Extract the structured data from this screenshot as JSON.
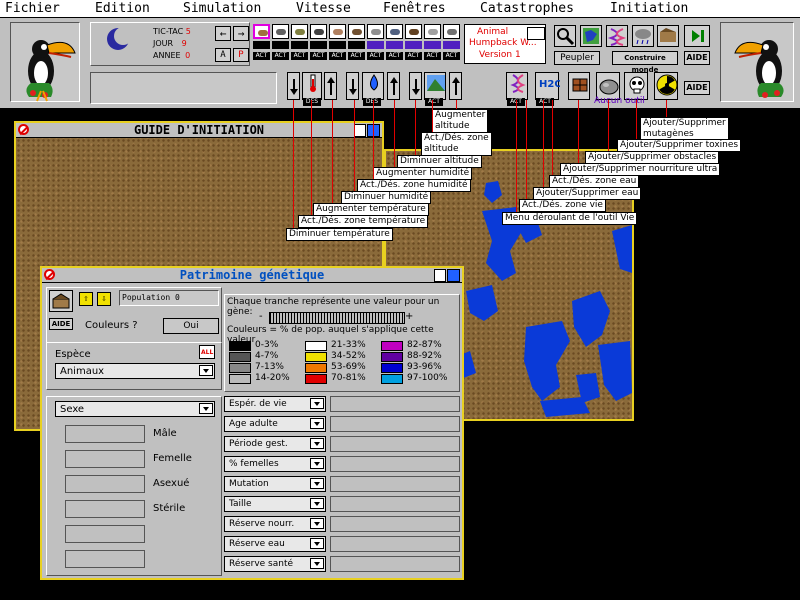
{
  "menu": [
    "Fichier",
    "Edition",
    "Simulation",
    "Vitesse",
    "Fenêtres",
    "Catastrophes",
    "Initiation"
  ],
  "counters": {
    "tictac_label": "TIC-TAC",
    "tictac_value": "5",
    "jour_label": "JOUR",
    "jour_value": "9",
    "annee_label": "ANNEE",
    "annee_value": "0"
  },
  "mode_buttons": {
    "a": "A",
    "p": "P"
  },
  "act_label": "ACT",
  "species_box": {
    "line1": "Animal",
    "line2": "Humpback W...",
    "line3": "Version 1"
  },
  "peupler": "Peupler",
  "construire_monde": "Construire monde",
  "aide": "AIDE",
  "des_label": "DES",
  "h2o_label": "H2O",
  "aucun_outil": "Aucun outil",
  "guide_title": "GUIDE D'INITIATION",
  "callouts": [
    "Augmenter\naltitude",
    "Act./Dés. zone\naltitude",
    "Diminuer altitude",
    "Augmenter humidité",
    "Act./Dés. zone humidité",
    "Diminuer humidité",
    "Augmenter température",
    "Act./Dés. zone température",
    "Diminuer température",
    "Ajouter/Supprimer\nmutagènes",
    "Ajouter/Supprimer toxines",
    "Ajouter/Supprimer obstacles",
    "Ajouter/Supprimer nourriture ultra",
    "Act./Dés. zone eau",
    "Ajouter/Supprimer eau",
    "Act./Dés. zone vie",
    "Menu déroulant de l'outil Vie"
  ],
  "genetic": {
    "title": "Patrimoine génétique",
    "population": "Population 0",
    "aide": "AIDE",
    "couleurs_label": "Couleurs ?",
    "oui": "Oui",
    "tranche_text": "Chaque tranche représente une valeur pour un gène:",
    "minus": "-",
    "plus": "+",
    "couleurs_text": "Couleurs = % de pop. auquel s'applique cette valeur",
    "legend": [
      {
        "label": "0-3%",
        "color": "#000000"
      },
      {
        "label": "4-7%",
        "color": "#555555"
      },
      {
        "label": "7-13%",
        "color": "#888888"
      },
      {
        "label": "14-20%",
        "color": "#bbbbbb"
      },
      {
        "label": "21-33%",
        "color": "#ffffff"
      },
      {
        "label": "34-52%",
        "color": "#f0e000"
      },
      {
        "label": "53-69%",
        "color": "#f07800"
      },
      {
        "label": "70-81%",
        "color": "#e00000"
      },
      {
        "label": "82-87%",
        "color": "#c000c0"
      },
      {
        "label": "88-92%",
        "color": "#6000a0"
      },
      {
        "label": "93-96%",
        "color": "#0000d0"
      },
      {
        "label": "97-100%",
        "color": "#00a0e0"
      }
    ],
    "espece_label": "Espèce",
    "espece_value": "Animaux",
    "sexe_value": "Sexe",
    "sexe_rows": [
      "Mâle",
      "Femelle",
      "Asexué",
      "Stérile"
    ],
    "genes": [
      "Espér. de vie",
      "Age adulte",
      "Période gest.",
      "% femelles",
      "Mutation",
      "Taille",
      "Réserve nourr.",
      "Réserve eau",
      "Réserve santé"
    ]
  },
  "colors": {
    "window_border": "#e8d020",
    "water": "#0a3ad8",
    "terrain": "#8a6a3a",
    "title_text": "#0050c0"
  }
}
